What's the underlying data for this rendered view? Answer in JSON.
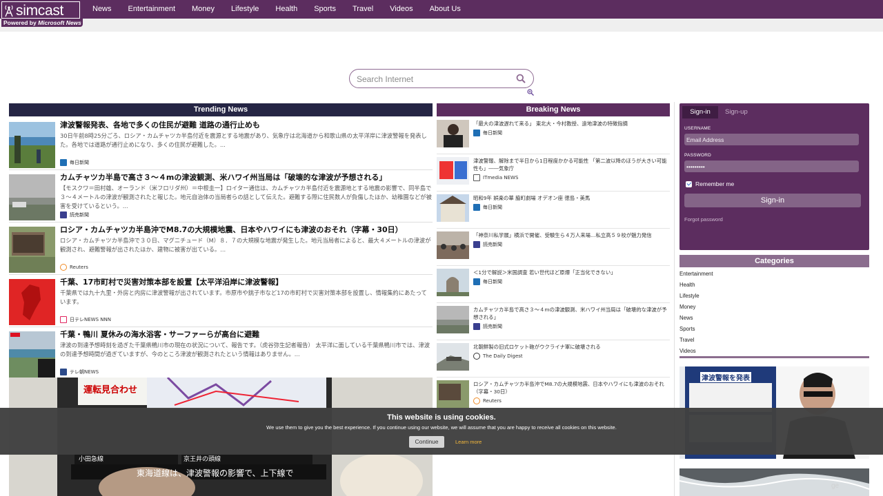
{
  "brand": {
    "name": "simcast",
    "powered_by_prefix": "Powered by ",
    "powered_by_name": "Microsoft News"
  },
  "nav": [
    "News",
    "Entertainment",
    "Money",
    "Lifestyle",
    "Health",
    "Sports",
    "Travel",
    "Videos",
    "About Us"
  ],
  "search": {
    "placeholder": "Search Internet"
  },
  "trending": {
    "header": "Trending News",
    "items": [
      {
        "title": "津波警報発表、各地で多くの住民が避難 道路の通行止めも",
        "desc": "30日午前8時25分ごろ、ロシア・カムチャツカ半島付近を震源とする地震があり、気象庁は北海道から和歌山県の太平洋岸に津波警報を発表した。各地では道路が通行止めになり、多くの住民が避難した。...",
        "source": "毎日新聞"
      },
      {
        "title": "カムチャツカ半島で高さ３～４mの津波観測、米ハワイ州当局は「破壊的な津波が予想される」",
        "desc": "【モスクワ＝田村雄、オーランド（米フロリダ州）＝中根圭一】ロイター通信は、カムチャツカ半島付近を震源地とする地震の影響で、同半島で３～４メートルの津波が観測されたと報じた。地元自治体の当局者らの話として伝えた。避難する際に住民数人が負傷したほか、幼稚園などが被害を受けているという。...",
        "source": "読売新聞"
      },
      {
        "title": "ロシア・カムチャツカ半島沖でM8.7の大規模地震、日本やハワイにも津波のおそれ（字幕・30日）",
        "desc": "ロシア・カムチャツカ半島沖で３０日、マグニチュード（M）８．７の大規模な地震が発生した。地元当局者によると、最大４メートルの津波が観測され、避難警報が出されたほか、建物に被害が出ている。...",
        "source": "Reuters"
      },
      {
        "title": "千葉、17市町村で災害対策本部を設置【太平洋沿岸に津波警報】",
        "desc": "千葉県では九十九里・外房と内房に津波警報が出されています。市原市や銚子市など17の市町村で災害対策本部を設置し、情報集約にあたっています。",
        "source": "日テレNEWS NNN"
      },
      {
        "title": "千葉・鴨川 夏休みの海水浴客・サーファーらが高台に避難",
        "desc": "津波の到達予想時刻を過ぎた千葉県鴨川市の現在の状況について、報告です。（虎谷弥生記者報告） 太平洋に面している千葉県鴨川市では、津波の到達予想時間が過ぎていますが、今のところ津波が観測されたという情報はありません。...",
        "source": "テレ朝NEWS"
      }
    ]
  },
  "breaking": {
    "header": "Breaking News",
    "items": [
      {
        "title": "「最大の津波遅れて来る」 東北大・今村教授、遠地津波の特徴指摘",
        "source": "毎日新聞"
      },
      {
        "title": "津波警報、解除まで半日から1日程度かかる可能性 「第二波以降のほうが大きい可能性も」――気象庁",
        "source": "ITmedia NEWS"
      },
      {
        "title": "昭和9年 娯楽の華 脇町劇場 オデオン座 徳島・美馬",
        "source": "毎日新聞"
      },
      {
        "title": "「神奈川私学展」横浜で開催、受験生ら４万人来場…私立高５９校が魅力発信",
        "source": "読売新聞"
      },
      {
        "title": "＜1分で解説＞米国調査 若い世代ほど原爆「正当化できない」",
        "source": "毎日新聞"
      },
      {
        "title": "カムチャツカ半島で高さ３～４mの津波観測、米ハワイ州当局は「破壊的な津波が予想される」",
        "source": "読売新聞"
      },
      {
        "title": "北朝鮮製の旧式ロケット砲がウクライナ軍に破壊される",
        "source": "The Daily Digest"
      },
      {
        "title": "ロシア・カムチャツカ半島沖でM8.7の大規模地震、日本やハワイにも津波のおそれ（字幕・30日）",
        "source": "Reuters"
      }
    ]
  },
  "signin": {
    "tab_signin": "Sign-in",
    "tab_signup": "Sign-up",
    "username_label": "USERNAME",
    "username_placeholder": "Email Address",
    "password_label": "PASSWORD",
    "password_value": "•••••••••",
    "remember": "Remember me",
    "button": "Sign-in",
    "forgot": "Forgot password"
  },
  "categories": {
    "header": "Categories",
    "items": [
      "Entertainment",
      "Health",
      "Lifestyle",
      "Money",
      "News",
      "Sports",
      "Travel",
      "Videos"
    ]
  },
  "big_image_text": {
    "line1": "運転見合わせ",
    "line2": "京王井の頭線",
    "line3": "東海道線は、津波警報の影響で、上下線で",
    "line4": "小田急線"
  },
  "side_image_text": {
    "line1": "津波警報を発表"
  },
  "cookie": {
    "title": "This website is using cookies.",
    "text": "We use them to give you the best experience. If you continue using our website, we will assume that you are happy to receive all cookies on this website.",
    "button": "Continue",
    "link": "Learn more"
  },
  "watermark": "ge",
  "colors": {
    "brand": "#5c2d5f",
    "accent": "#8b6d8e",
    "trending_head": "#252544",
    "breaking_head": "#5c2d5f"
  }
}
